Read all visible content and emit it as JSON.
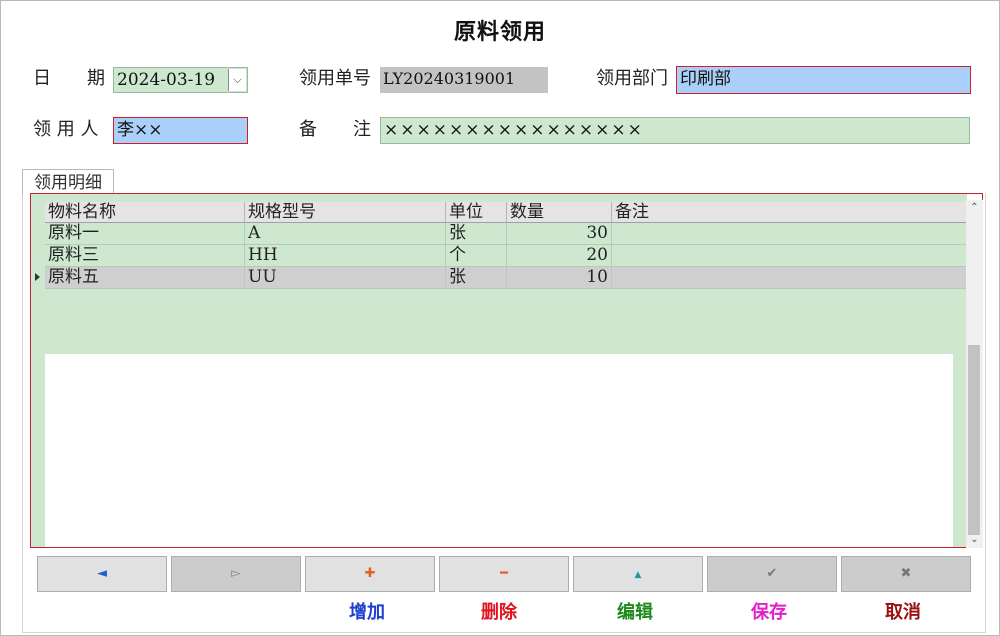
{
  "title": "原料领用",
  "form": {
    "date_label": "日　　期",
    "date_value": "2024-03-19",
    "order_no_label": "领用单号",
    "order_no_value": "LY20240319001",
    "department_label": "领用部门",
    "department_value": "印刷部",
    "user_label": "领 用 人",
    "user_value": "李××",
    "remark_label": "备　　注",
    "remark_value": "××××××××××××××××"
  },
  "tab_label": "领用明细",
  "grid": {
    "columns": [
      "物料名称",
      "规格型号",
      "单位",
      "数量",
      "备注"
    ],
    "rows": [
      {
        "name": "原料一",
        "spec": "A",
        "unit": "张",
        "qty": "30",
        "note": ""
      },
      {
        "name": "原料三",
        "spec": "HH",
        "unit": "个",
        "qty": "20",
        "note": ""
      },
      {
        "name": "原料五",
        "spec": "UU",
        "unit": "张",
        "qty": "10",
        "note": ""
      }
    ],
    "selected_row": 2
  },
  "nav_buttons": [
    {
      "icon": "prev-icon",
      "glyph": "◄",
      "color": "#1f5fd0"
    },
    {
      "icon": "next-icon",
      "glyph": "▻",
      "color": "#888888"
    },
    {
      "icon": "plus-icon",
      "glyph": "✚",
      "color": "#e0641e"
    },
    {
      "icon": "minus-icon",
      "glyph": "━",
      "color": "#e0641e"
    },
    {
      "icon": "up-arrow-icon",
      "glyph": "▲",
      "color": "#1a9a9a"
    },
    {
      "icon": "check-icon",
      "glyph": "✔",
      "color": "#777777"
    },
    {
      "icon": "close-icon",
      "glyph": "✖",
      "color": "#777777"
    }
  ],
  "actions": {
    "add": "增加",
    "delete": "删除",
    "edit": "编辑",
    "save": "保存",
    "cancel": "取消"
  },
  "colors": {
    "add": "#1f3fd0",
    "delete": "#e0141e",
    "edit": "#1e8a1e",
    "save": "#e020c8",
    "cancel": "#9a1010"
  }
}
